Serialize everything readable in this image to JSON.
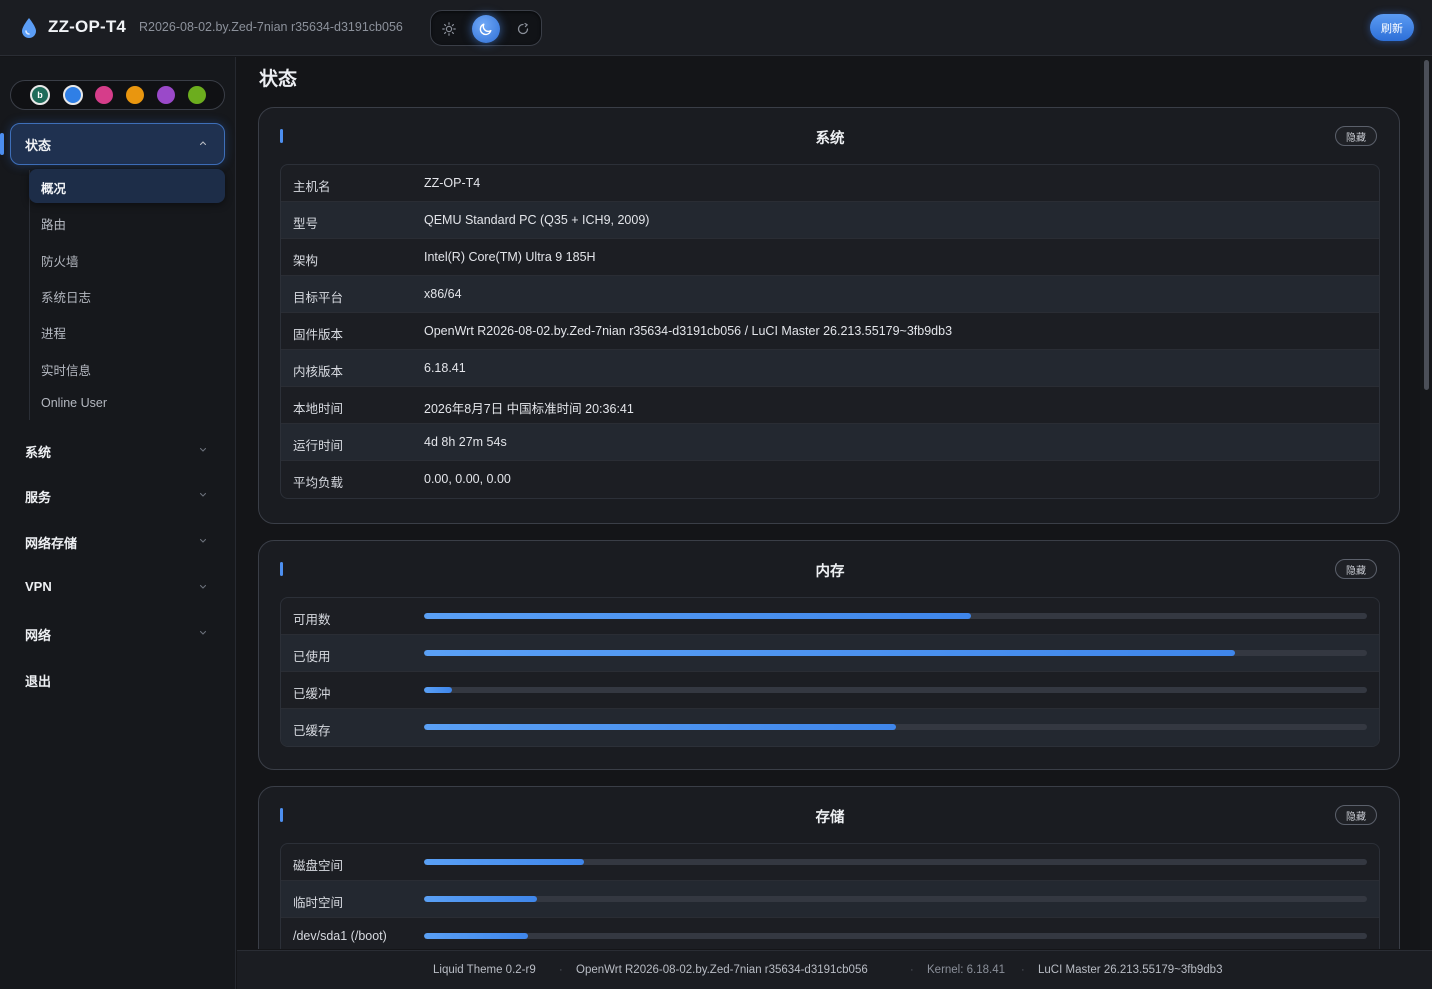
{
  "header": {
    "brand": "ZZ-OP-T4",
    "version": "R2026-08-02.by.Zed-7nian r35634-d3191cb056",
    "refresh_label": "刷新",
    "theme_options": [
      "light",
      "dark",
      "auto"
    ],
    "theme_selected": "dark"
  },
  "sidebar": {
    "swatches": [
      {
        "label": "b",
        "color": "#1f6b5a"
      },
      {
        "color": "#2f7fe6"
      },
      {
        "color": "#d63d8a"
      },
      {
        "color": "#e9960f"
      },
      {
        "color": "#9a49c9"
      },
      {
        "color": "#6cad1e"
      }
    ],
    "active_section": "状态",
    "subitems": [
      "概况",
      "路由",
      "防火墙",
      "系统日志",
      "进程",
      "实时信息",
      "Online User"
    ],
    "active_subitem": "概况",
    "sections": [
      "系统",
      "服务",
      "网络存储",
      "VPN",
      "网络",
      "退出"
    ]
  },
  "main": {
    "page_title": "状态",
    "hide_label": "隐藏",
    "system": {
      "title": "系统",
      "rows": [
        {
          "key": "主机名",
          "value": "ZZ-OP-T4"
        },
        {
          "key": "型号",
          "value": "QEMU Standard PC (Q35 + ICH9, 2009)"
        },
        {
          "key": "架构",
          "value": "Intel(R) Core(TM) Ultra 9 185H"
        },
        {
          "key": "目标平台",
          "value": "x86/64"
        },
        {
          "key": "固件版本",
          "value": "OpenWrt R2026-08-02.by.Zed-7nian r35634-d3191cb056 / LuCI Master 26.213.55179~3fb9db3"
        },
        {
          "key": "内核版本",
          "value": "6.18.41"
        },
        {
          "key": "本地时间",
          "value": "2026年8月7日 中国标准时间 20:36:41"
        },
        {
          "key": "运行时间",
          "value": "4d 8h 27m 54s"
        },
        {
          "key": "平均负载",
          "value": "0.00, 0.00, 0.00"
        }
      ]
    },
    "memory": {
      "title": "内存",
      "rows": [
        {
          "key": "可用数",
          "fraction": 0.58
        },
        {
          "key": "已使用",
          "fraction": 0.86
        },
        {
          "key": "已缓冲",
          "fraction": 0.03
        },
        {
          "key": "已缓存",
          "fraction": 0.5
        }
      ]
    },
    "storage": {
      "title": "存储",
      "rows": [
        {
          "key": "磁盘空间",
          "fraction": 0.17
        },
        {
          "key": "临时空间",
          "fraction": 0.12
        },
        {
          "key": "/dev/sda1 (/boot)",
          "fraction": 0.11
        }
      ]
    }
  },
  "footer": {
    "theme": "Liquid Theme 0.2-r9",
    "firmware": "OpenWrt R2026-08-02.by.Zed-7nian r35634-d3191cb056",
    "kernel": "Kernel: 6.18.41",
    "luci": "LuCI Master 26.213.55179~3fb9db3"
  }
}
